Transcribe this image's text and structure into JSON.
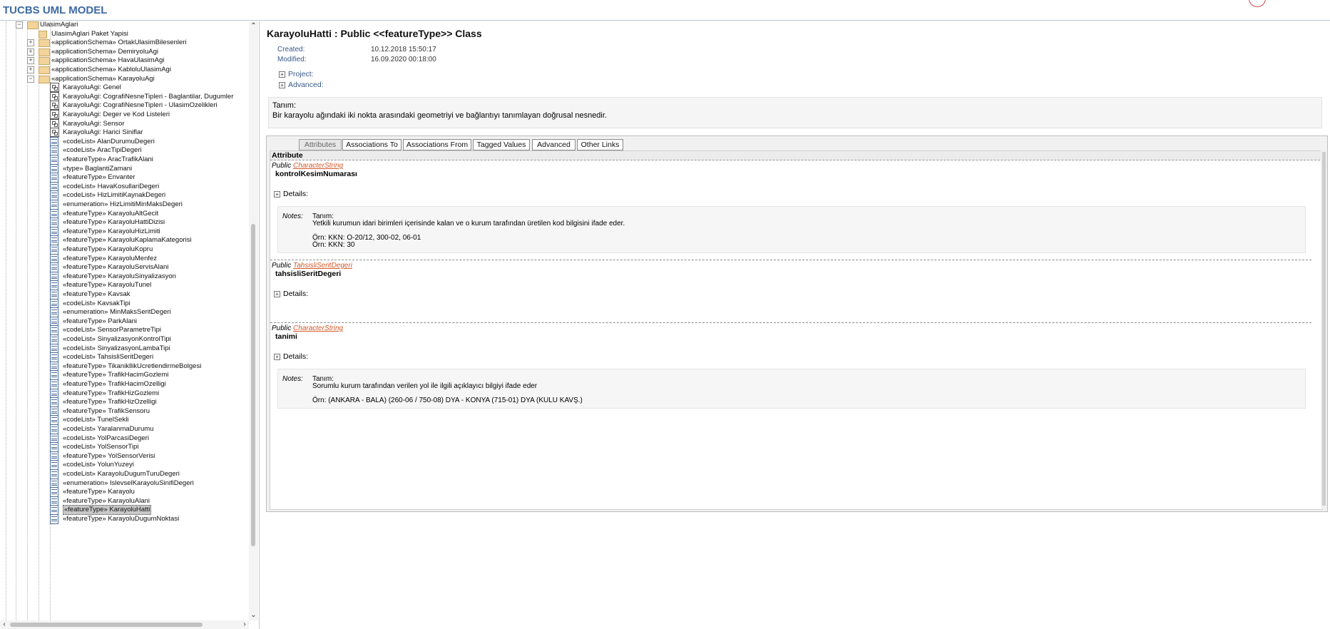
{
  "header": {
    "title": "TUCBS UML MODEL",
    "logo_text": ""
  },
  "tree": {
    "items": [
      {
        "label": "UlasimAglari",
        "icon": "folder-icon",
        "level": 0,
        "expander": "−"
      },
      {
        "label": "UlasimAglari Paket Yapisi",
        "icon": "package-diagram-icon",
        "level": 1,
        "expander": ""
      },
      {
        "label": "«applicationSchema» OrtakUlasimBilesenleri",
        "icon": "folder-icon",
        "level": 1,
        "expander": "+"
      },
      {
        "label": "«applicationSchema» DemiryoluAgi",
        "icon": "folder-icon",
        "level": 1,
        "expander": "+"
      },
      {
        "label": "«applicationSchema» HavaUlasimAgi",
        "icon": "folder-icon",
        "level": 1,
        "expander": "+"
      },
      {
        "label": "«applicationSchema» KabloluUlasimAgi",
        "icon": "folder-icon",
        "level": 1,
        "expander": "+"
      },
      {
        "label": "«applicationSchema» KarayoluAgi",
        "icon": "folder-icon",
        "level": 1,
        "expander": "−"
      },
      {
        "label": "KarayoluAgi: Genel",
        "icon": "diagram-icon",
        "level": 2,
        "expander": ""
      },
      {
        "label": "KarayoluAgi: CografiNesneTipleri - Baglantilar, Dugumler",
        "icon": "diagram-icon",
        "level": 2,
        "expander": ""
      },
      {
        "label": "KarayoluAgi: CografiNesneTipleri - UlasimOzelikleri",
        "icon": "diagram-icon",
        "level": 2,
        "expander": ""
      },
      {
        "label": "KarayoluAgi: Deger ve Kod Listeleri",
        "icon": "diagram-icon",
        "level": 2,
        "expander": ""
      },
      {
        "label": "KarayoluAgi: Sensor",
        "icon": "diagram-icon",
        "level": 2,
        "expander": ""
      },
      {
        "label": "KarayoluAgi: Harici Siniflar",
        "icon": "diagram-icon",
        "level": 2,
        "expander": ""
      },
      {
        "label": "«codeList» AlanDurumuDegeri",
        "icon": "class-icon",
        "level": 2,
        "expander": ""
      },
      {
        "label": "«codeList» AracTipiDegeri",
        "icon": "class-icon",
        "level": 2,
        "expander": ""
      },
      {
        "label": "«featureType» AracTrafikAlani",
        "icon": "class-icon",
        "level": 2,
        "expander": ""
      },
      {
        "label": "«type» BaglantiZamani",
        "icon": "class-icon",
        "level": 2,
        "expander": ""
      },
      {
        "label": "«featureType» Envanter",
        "icon": "class-icon",
        "level": 2,
        "expander": ""
      },
      {
        "label": "«codeList» HavaKosullariDegeri",
        "icon": "class-icon",
        "level": 2,
        "expander": ""
      },
      {
        "label": "«codeList» HizLimitiKaynakDegeri",
        "icon": "class-icon",
        "level": 2,
        "expander": ""
      },
      {
        "label": "«enumeration» HizLimitiMinMaksDegeri",
        "icon": "class-icon",
        "level": 2,
        "expander": ""
      },
      {
        "label": "«featureType» KarayoluAltGecit",
        "icon": "class-icon",
        "level": 2,
        "expander": ""
      },
      {
        "label": "«featureType» KarayoluHattiDizisi",
        "icon": "class-icon",
        "level": 2,
        "expander": ""
      },
      {
        "label": "«featureType» KarayoluHizLimiti",
        "icon": "class-icon",
        "level": 2,
        "expander": ""
      },
      {
        "label": "«featureType» KarayoluKaplamaKategorisi",
        "icon": "class-icon",
        "level": 2,
        "expander": ""
      },
      {
        "label": "«featureType» KarayoluKopru",
        "icon": "class-icon",
        "level": 2,
        "expander": ""
      },
      {
        "label": "«featureType» KarayoluMenfez",
        "icon": "class-icon",
        "level": 2,
        "expander": ""
      },
      {
        "label": "«featureType» KarayoluServisAlani",
        "icon": "class-icon",
        "level": 2,
        "expander": ""
      },
      {
        "label": "«featureType» KarayoluSinyalizasyon",
        "icon": "class-icon",
        "level": 2,
        "expander": ""
      },
      {
        "label": "«featureType» KarayoluTunel",
        "icon": "class-icon",
        "level": 2,
        "expander": ""
      },
      {
        "label": "«featureType» Kavsak",
        "icon": "class-icon",
        "level": 2,
        "expander": ""
      },
      {
        "label": "«codeList» KavsakTipi",
        "icon": "class-icon",
        "level": 2,
        "expander": ""
      },
      {
        "label": "«enumeration» MinMaksSeritDegeri",
        "icon": "class-icon",
        "level": 2,
        "expander": ""
      },
      {
        "label": "«featureType» ParkAlani",
        "icon": "class-icon",
        "level": 2,
        "expander": ""
      },
      {
        "label": "«codeList» SensorParametreTipi",
        "icon": "class-icon",
        "level": 2,
        "expander": ""
      },
      {
        "label": "«codeList» SinyalizasyonKontrolTipi",
        "icon": "class-icon",
        "level": 2,
        "expander": ""
      },
      {
        "label": "«codeList» SinyalizasyonLambaTipi",
        "icon": "class-icon",
        "level": 2,
        "expander": ""
      },
      {
        "label": "«codeList» TahsisliSeritDegeri",
        "icon": "class-icon",
        "level": 2,
        "expander": ""
      },
      {
        "label": "«featureType» TikanikllikUcretlendirmeBolgesi",
        "icon": "class-icon",
        "level": 2,
        "expander": ""
      },
      {
        "label": "«featureType» TrafikHacimGozlemi",
        "icon": "class-icon",
        "level": 2,
        "expander": ""
      },
      {
        "label": "«featureType» TrafikHacimOzelligi",
        "icon": "class-icon",
        "level": 2,
        "expander": ""
      },
      {
        "label": "«featureType» TrafikHizGozlemi",
        "icon": "class-icon",
        "level": 2,
        "expander": ""
      },
      {
        "label": "«featureType» TrafikHizOzelligi",
        "icon": "class-icon",
        "level": 2,
        "expander": ""
      },
      {
        "label": "«featureType» TrafikSensoru",
        "icon": "class-icon",
        "level": 2,
        "expander": ""
      },
      {
        "label": "«codeList» TunelSekli",
        "icon": "class-icon",
        "level": 2,
        "expander": ""
      },
      {
        "label": "«codeList» YaralanmaDurumu",
        "icon": "class-icon",
        "level": 2,
        "expander": ""
      },
      {
        "label": "«codeList» YolParcasiDegeri",
        "icon": "class-icon",
        "level": 2,
        "expander": ""
      },
      {
        "label": "«codeList» YolSensorTipi",
        "icon": "class-icon",
        "level": 2,
        "expander": ""
      },
      {
        "label": "«featureType» YolSensorVerisi",
        "icon": "class-icon",
        "level": 2,
        "expander": ""
      },
      {
        "label": "«codeList» YolunYuzeyi",
        "icon": "class-icon",
        "level": 2,
        "expander": ""
      },
      {
        "label": "«codeList» KarayoluDugumTuruDegeri",
        "icon": "class-icon",
        "level": 2,
        "expander": ""
      },
      {
        "label": "«enumeration» IslevselKarayoluSinifiDegeri",
        "icon": "class-icon",
        "level": 2,
        "expander": ""
      },
      {
        "label": "«featureType» Karayolu",
        "icon": "class-icon",
        "level": 2,
        "expander": ""
      },
      {
        "label": "«featureType» KarayoluAlani",
        "icon": "class-icon",
        "level": 2,
        "expander": ""
      },
      {
        "label": "«featureType» KarayoluHatti",
        "icon": "class-icon",
        "level": 2,
        "expander": "",
        "selected": true
      },
      {
        "label": "«featureType» KarayoluDugumNoktasi",
        "icon": "class-icon",
        "level": 2,
        "expander": ""
      }
    ]
  },
  "detail": {
    "title": "KarayoluHatti : Public <<featureType>> Class",
    "created_label": "Created:",
    "created_value": "10.12.2018 15:50:17",
    "modified_label": "Modified:",
    "modified_value": "16.09.2020 00:18:00",
    "project_label": "Project:",
    "advanced_label": "Advanced:",
    "description_label": "Tanım:",
    "description_text": "Bir karayolu ağındaki iki nokta arasındaki geometriyi ve bağlantıyı tanımlayan doğrusal nesnedir."
  },
  "tabs": [
    {
      "label": "Attributes",
      "active": true
    },
    {
      "label": "Associations To",
      "active": false
    },
    {
      "label": "Associations From",
      "active": false
    },
    {
      "label": "Tagged Values",
      "active": false
    },
    {
      "label": "Advanced",
      "active": false
    },
    {
      "label": "Other Links",
      "active": false
    }
  ],
  "attributes": {
    "header": "Attribute",
    "visibility": "Public",
    "details_label": "Details:",
    "notes_label": "Notes:",
    "items": [
      {
        "type": "CharacterString",
        "name": "kontrolKesimNumarası",
        "notes": [
          "Tanım:",
          "Yetkili kurumun idari birimleri içerisinde kalan ve o kurum tarafından üretilen kod bilgisini ifade eder.",
          "",
          "Örn: KKN: O-20/12, 300-02, 06-01",
          "Örn: KKN: 30"
        ]
      },
      {
        "type": "TahsisliSeritDegeri",
        "name": "tahsisliSeritDegeri",
        "notes": []
      },
      {
        "type": "CharacterString",
        "name": "tanimi",
        "notes": [
          "Tanım:",
          "Sorumlu kurum tarafından verilen yol ile ilgili açıklayıcı bilgiyi ifade eder",
          "",
          "Örn: (ANKARA - BALA) (260-06 / 750-08) DYA - KONYA (715-01) DYA (KULU KAVŞ.)"
        ]
      }
    ]
  },
  "colors": {
    "brand": "#3d6aa3",
    "link": "#d45a2a",
    "label": "#3a5a8a"
  }
}
